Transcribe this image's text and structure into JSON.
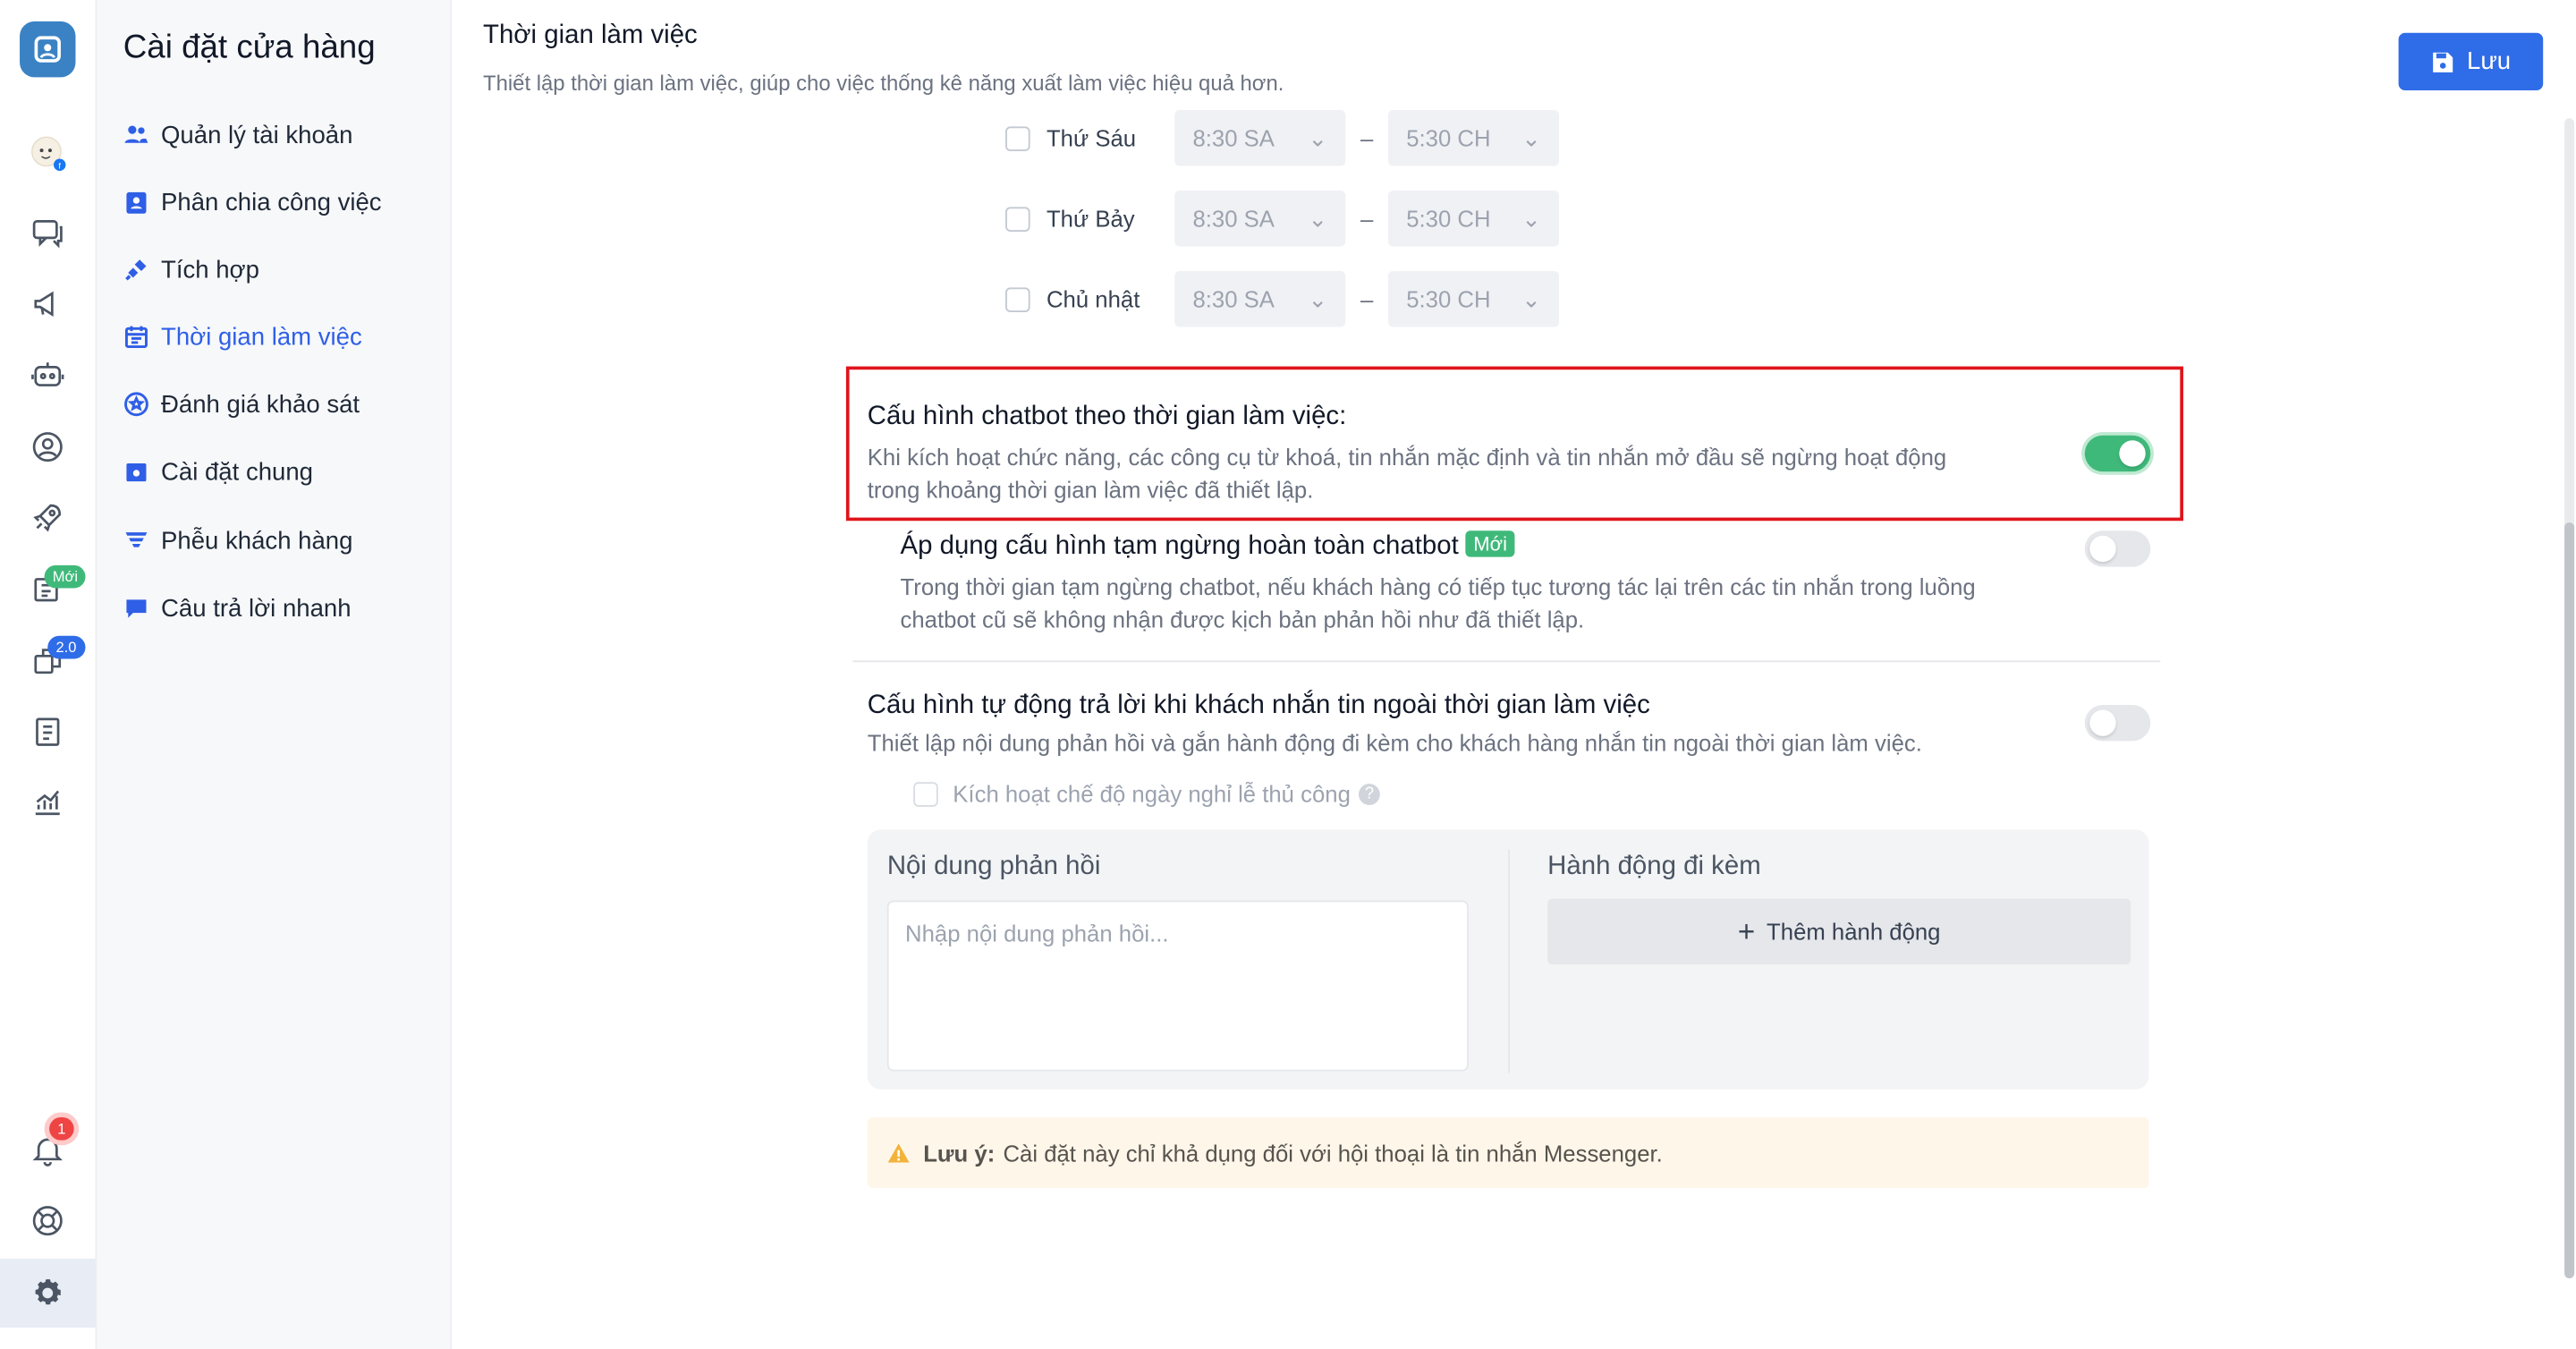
{
  "sidebar": {
    "title": "Cài đặt cửa hàng",
    "items": [
      {
        "label": "Quản lý tài khoản",
        "icon": "users-icon"
      },
      {
        "label": "Phân chia công việc",
        "icon": "badge-icon"
      },
      {
        "label": "Tích hợp",
        "icon": "plug-icon"
      },
      {
        "label": "Thời gian làm việc",
        "icon": "calendar-icon",
        "active": true
      },
      {
        "label": "Đánh giá khảo sát",
        "icon": "star-circle-icon"
      },
      {
        "label": "Cài đặt chung",
        "icon": "settings-calendar-icon"
      },
      {
        "label": "Phễu khách hàng",
        "icon": "funnel-icon"
      },
      {
        "label": "Câu trả lời nhanh",
        "icon": "chat-icon"
      }
    ]
  },
  "rail": {
    "badge_new": "Mới",
    "badge_version": "2.0",
    "notification_count": "1"
  },
  "header": {
    "title": "Thời gian làm việc",
    "subtitle": "Thiết lập thời gian làm việc, giúp cho việc thống kê năng xuất làm việc hiệu quả hơn.",
    "save_label": "Lưu"
  },
  "schedule": [
    {
      "day": "Thứ Sáu",
      "start": "8:30 SA",
      "end": "5:30 CH"
    },
    {
      "day": "Thứ Bảy",
      "start": "8:30 SA",
      "end": "5:30 CH"
    },
    {
      "day": "Chủ nhật",
      "start": "8:30 SA",
      "end": "5:30 CH"
    }
  ],
  "settings": {
    "chatbot": {
      "title": "Cấu hình chatbot theo thời gian làm việc:",
      "desc1": "Khi kích hoạt chức năng, các công cụ từ khoá, tin nhắn mặc định và tin nhắn mở đầu sẽ ngừng hoạt động",
      "desc2": "trong khoảng thời gian làm việc đã thiết lập.",
      "enabled": true
    },
    "pause": {
      "title": "Áp dụng cấu hình tạm ngừng hoàn toàn chatbot",
      "badge": "Mới",
      "desc1": "Trong thời gian tạm ngừng chatbot, nếu khách hàng có tiếp tục tương tác lại trên các tin nhắn trong luồng",
      "desc2": "chatbot cũ sẽ không nhận được kịch bản phản hồi như đã thiết lập.",
      "enabled": false
    },
    "auto_reply": {
      "title": "Cấu hình tự động trả lời khi khách nhắn tin ngoài thời gian làm việc",
      "desc": "Thiết lập nội dung phản hồi và gắn hành động đi kèm cho khách hàng nhắn tin ngoài thời gian làm việc.",
      "enabled": false,
      "holiday_label": "Kích hoạt chế độ ngày nghỉ lễ thủ công"
    }
  },
  "reply_panel": {
    "content_label": "Nội dung phản hồi",
    "content_placeholder": "Nhập nội dung phản hồi...",
    "action_label": "Hành động đi kèm",
    "add_action": "Thêm hành động"
  },
  "note": {
    "bold": "Lưu ý:",
    "text": "Cài đặt này chỉ khả dụng đối với hội thoại là tin nhắn Messenger."
  },
  "colors": {
    "primary": "#2f6ce8",
    "toggle_on": "#3fb97a",
    "highlight_border": "#e0141b",
    "note_bg": "#fef6e9"
  }
}
